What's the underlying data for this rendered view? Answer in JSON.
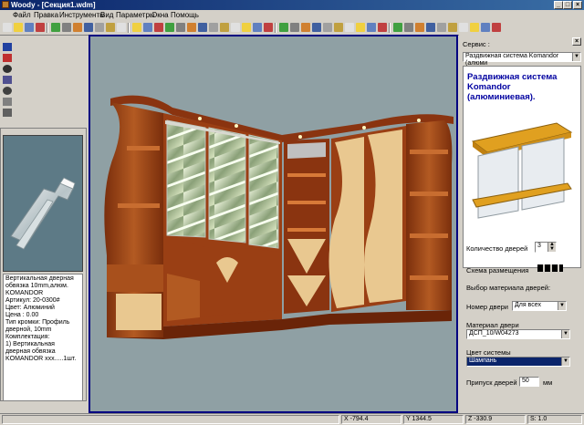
{
  "window": {
    "title": "Woody - [Секция1.wdm]"
  },
  "menu": [
    "Файл",
    "Правка",
    "Инструменты",
    "Вид",
    "Параметры",
    "Окна",
    "Помощь"
  ],
  "properties": [
    "Вертикальная дверная",
    "обвязка 10mm,алюм.",
    "KOMANDOR",
    "Артикул: 20-0300#",
    "Цвет: Алюминий",
    "Цена : 0.00",
    "Тип кромки: Профиль",
    "дверной, 10mm",
    "Комплектация:",
    "1) Вертикальная",
    "дверная обвязка",
    "KOMANDOR xxx.....1шт."
  ],
  "service": {
    "label": "Сервис :",
    "system_select": "Раздвижная система Komandor (алюми",
    "heading_line1": "Раздвижная система",
    "heading_line2": "Komandor",
    "heading_line3": "(алюминиевая).",
    "doors_count_label": "Количество дверей",
    "doors_count_value": "3",
    "layout_label": "Схема размещения",
    "material_choice_label": "Выбор материала дверей:",
    "door_number_label": "Номер двери",
    "door_number_value": "Для всех",
    "door_material_label": "Материал двери",
    "door_material_value": "ДСП_10/W04273",
    "system_color_label": "Цвет системы",
    "system_color_value": "Шампань",
    "door_allowance_label": "Припуск дверей",
    "door_allowance_value": "50",
    "door_allowance_unit": "мм"
  },
  "status": {
    "x": "-794.4",
    "y": "1344.5",
    "z": "-330.9",
    "s": "S: 1.0"
  },
  "colors": {
    "titlebar": "#0a246a",
    "viewport_bg": "#8fa0a4",
    "heading": "#0000a0",
    "selected": "#0a246a",
    "wood": "#9a3f14",
    "light_wood": "#e9c890"
  }
}
